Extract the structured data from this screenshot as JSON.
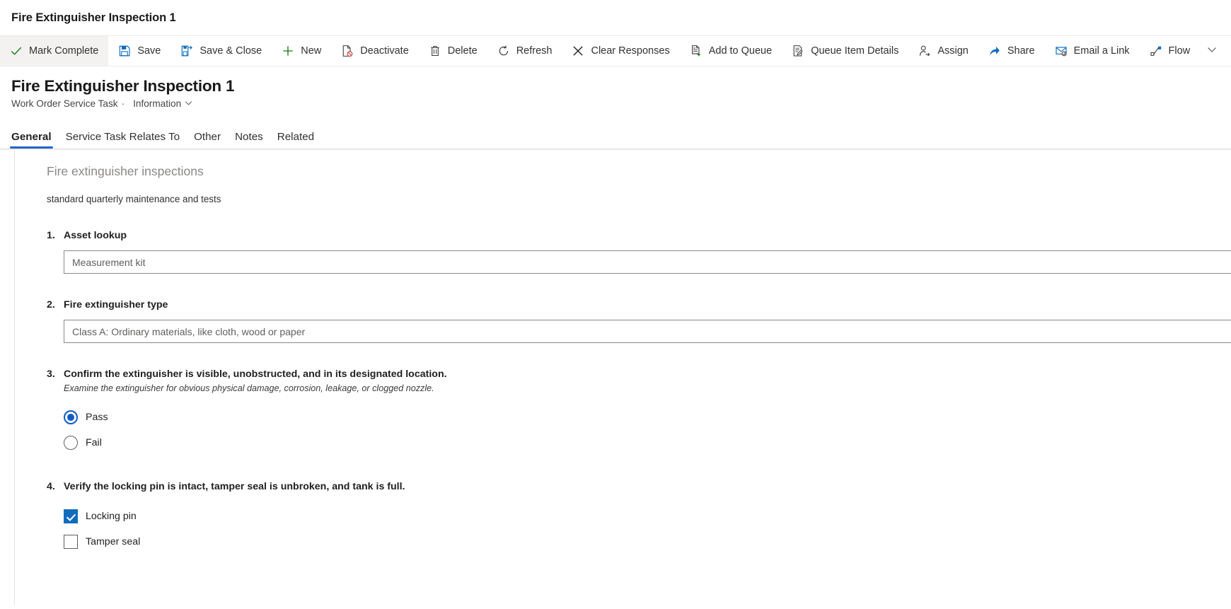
{
  "app": {
    "window_title": "Fire Extinguisher Inspection 1"
  },
  "command_bar": {
    "items": [
      {
        "label": "Mark Complete",
        "icon": "checkmark-icon",
        "state": "active"
      },
      {
        "label": "Save",
        "icon": "save-icon",
        "state": "normal"
      },
      {
        "label": "Save & Close",
        "icon": "save-and-close-icon",
        "state": "normal"
      },
      {
        "label": "New",
        "icon": "plus-icon",
        "state": "normal"
      },
      {
        "label": "Deactivate",
        "icon": "deactivate-icon",
        "state": "normal"
      },
      {
        "label": "Delete",
        "icon": "trash-icon",
        "state": "normal"
      },
      {
        "label": "Refresh",
        "icon": "refresh-icon",
        "state": "normal"
      },
      {
        "label": "Clear Responses",
        "icon": "close-x-icon",
        "state": "normal"
      },
      {
        "label": "Add to Queue",
        "icon": "add-to-queue-icon",
        "state": "normal"
      },
      {
        "label": "Queue Item Details",
        "icon": "queue-item-details-icon",
        "state": "normal"
      },
      {
        "label": "Assign",
        "icon": "assign-person-icon",
        "state": "normal"
      },
      {
        "label": "Share",
        "icon": "share-icon",
        "state": "normal"
      },
      {
        "label": "Email a Link",
        "icon": "email-link-icon",
        "state": "normal"
      },
      {
        "label": "Flow",
        "icon": "flow-icon",
        "state": "normal"
      }
    ],
    "overflow_icon": "chevron-down-icon"
  },
  "record": {
    "title": "Fire Extinguisher Inspection 1",
    "entity": "Work Order Service Task",
    "separator": "·",
    "form_name": "Information",
    "form_chevron_icon": "chevron-down-icon"
  },
  "tabs": [
    {
      "label": "General",
      "selected": true
    },
    {
      "label": "Service Task Relates To",
      "selected": false
    },
    {
      "label": "Other",
      "selected": false
    },
    {
      "label": "Notes",
      "selected": false
    },
    {
      "label": "Related",
      "selected": false
    }
  ],
  "form": {
    "section_title": "Fire extinguisher inspections",
    "section_description": "standard quarterly maintenance and tests",
    "questions": [
      {
        "number": "1.",
        "label": "Asset lookup",
        "hint": "",
        "type": "text",
        "value": "",
        "placeholder": "Measurement kit"
      },
      {
        "number": "2.",
        "label": "Fire extinguisher type",
        "hint": "",
        "type": "text",
        "value": "",
        "placeholder": "Class A: Ordinary materials, like cloth, wood or paper"
      },
      {
        "number": "3.",
        "label": "Confirm the extinguisher is visible, unobstructed, and in its designated location.",
        "hint": "Examine the extinguisher for obvious physical damage, corrosion, leakage, or clogged nozzle.",
        "type": "radio",
        "options": [
          {
            "label": "Pass",
            "checked": true
          },
          {
            "label": "Fail",
            "checked": false
          }
        ]
      },
      {
        "number": "4.",
        "label": "Verify the locking pin is intact, tamper seal is unbroken, and tank is full.",
        "hint": "",
        "type": "checkbox",
        "options": [
          {
            "label": "Locking pin",
            "checked": true
          },
          {
            "label": "Tamper seal",
            "checked": false
          }
        ]
      }
    ]
  },
  "colors": {
    "accent": "#2266c8",
    "checked_blue": "#0f6cbd",
    "radio_blue": "#0f5bc4",
    "success_green": "#107c10",
    "icon_blue": "#0f6cbd",
    "text_primary": "#201f1e",
    "text_secondary": "#605e5c"
  }
}
